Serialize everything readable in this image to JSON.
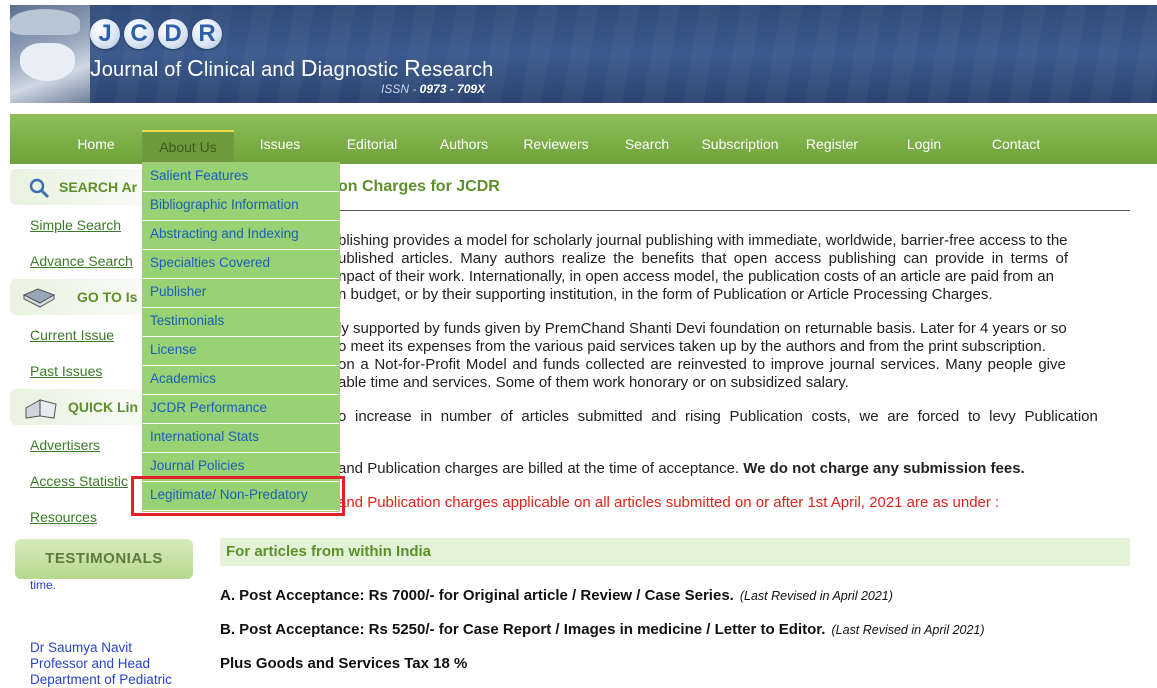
{
  "header": {
    "logo_letters": [
      "J",
      "C",
      "D",
      "R"
    ],
    "journal_name_parts": [
      "J",
      "ournal of ",
      "C",
      "linical and ",
      "D",
      "iagnostic ",
      "R",
      "esearch"
    ],
    "issn_label": "ISSN - ",
    "issn_value": "0973 - 709X"
  },
  "nav": {
    "items": [
      "Home",
      "About Us",
      "Issues",
      "Editorial",
      "Authors",
      "Reviewers",
      "Search",
      "Subscription",
      "Register",
      "Login",
      "Contact"
    ],
    "active": "About Us"
  },
  "dropdown": {
    "items": [
      "Salient Features",
      "Bibliographic Information",
      "Abstracting and Indexing",
      "Specialties Covered",
      "Publisher",
      "Testimonials",
      "License",
      "Academics",
      "JCDR Performance",
      "International Stats",
      "Journal Policies",
      "Legitimate/ Non-Predatory"
    ],
    "highlighted": "Legitimate/ Non-Predatory"
  },
  "sidebar": {
    "search_title": "SEARCH Ar",
    "search_links": [
      "Simple Search",
      "Advance Search"
    ],
    "goto_title": "GO TO Is",
    "goto_links": [
      "Current Issue",
      "Past Issues"
    ],
    "quick_title": "QUICK Lin",
    "quick_links": [
      "Advertisers",
      "Access Statistic",
      "Resources"
    ],
    "testimonials_title": "TESTIMONIALS",
    "testimonial_lines": [
      "time.",
      "Dr Saumya Navit",
      "Professor and Head",
      "Department of Pediatric"
    ]
  },
  "main": {
    "title": "on Charges for JCDR",
    "para1": [
      "blishing provides a model for scholarly journal publishing with immediate, worldwide, barrier-free access to the",
      "ublished articles. Many authors realize the benefits that open access publishing can provide in terms of",
      "npact of their work. Internationally, in open access model, the publication costs of an article are paid from an",
      "n budget, or by their supporting institution, in the form of Publication or Article Processing Charges."
    ],
    "para2": [
      "ly supported by funds given by PremChand Shanti Devi foundation on returnable basis. Later for 4 years or so",
      "o meet its expenses from the various paid services taken up by the authors and from the print subscription.",
      "on a Not-for-Profit Model and funds collected are reinvested to improve journal services. Many people give",
      "able time and services. Some of them work honorary or on subsidized salary."
    ],
    "para3": [
      "o increase in number of articles submitted and rising Publication costs, we are forced to levy Publication"
    ],
    "billing_text": "and Publication charges are billed at the time of acceptance. ",
    "billing_bold": "We do not charge any submission fees.",
    "red_text": "and Publication charges applicable on all articles submitted on or after 1st April, 2021 are as under :",
    "india_header": "For articles from within India",
    "charge_a": "A. Post Acceptance: Rs 7000/- for Original article / Review / Case Series.",
    "charge_a_note": "(Last Revised in April 2021)",
    "charge_b": "B. Post Acceptance: Rs 5250/- for Case Report / Images in medicine / Letter to Editor.",
    "charge_b_note": "(Last Revised in April 2021)",
    "gst": "Plus Goods and Services Tax 18 %"
  },
  "colors": {
    "nav_green": "#7fb04a",
    "dropdown_green": "#99d274",
    "highlight_red": "#e3202a",
    "heading_green": "#5d8f2a"
  }
}
